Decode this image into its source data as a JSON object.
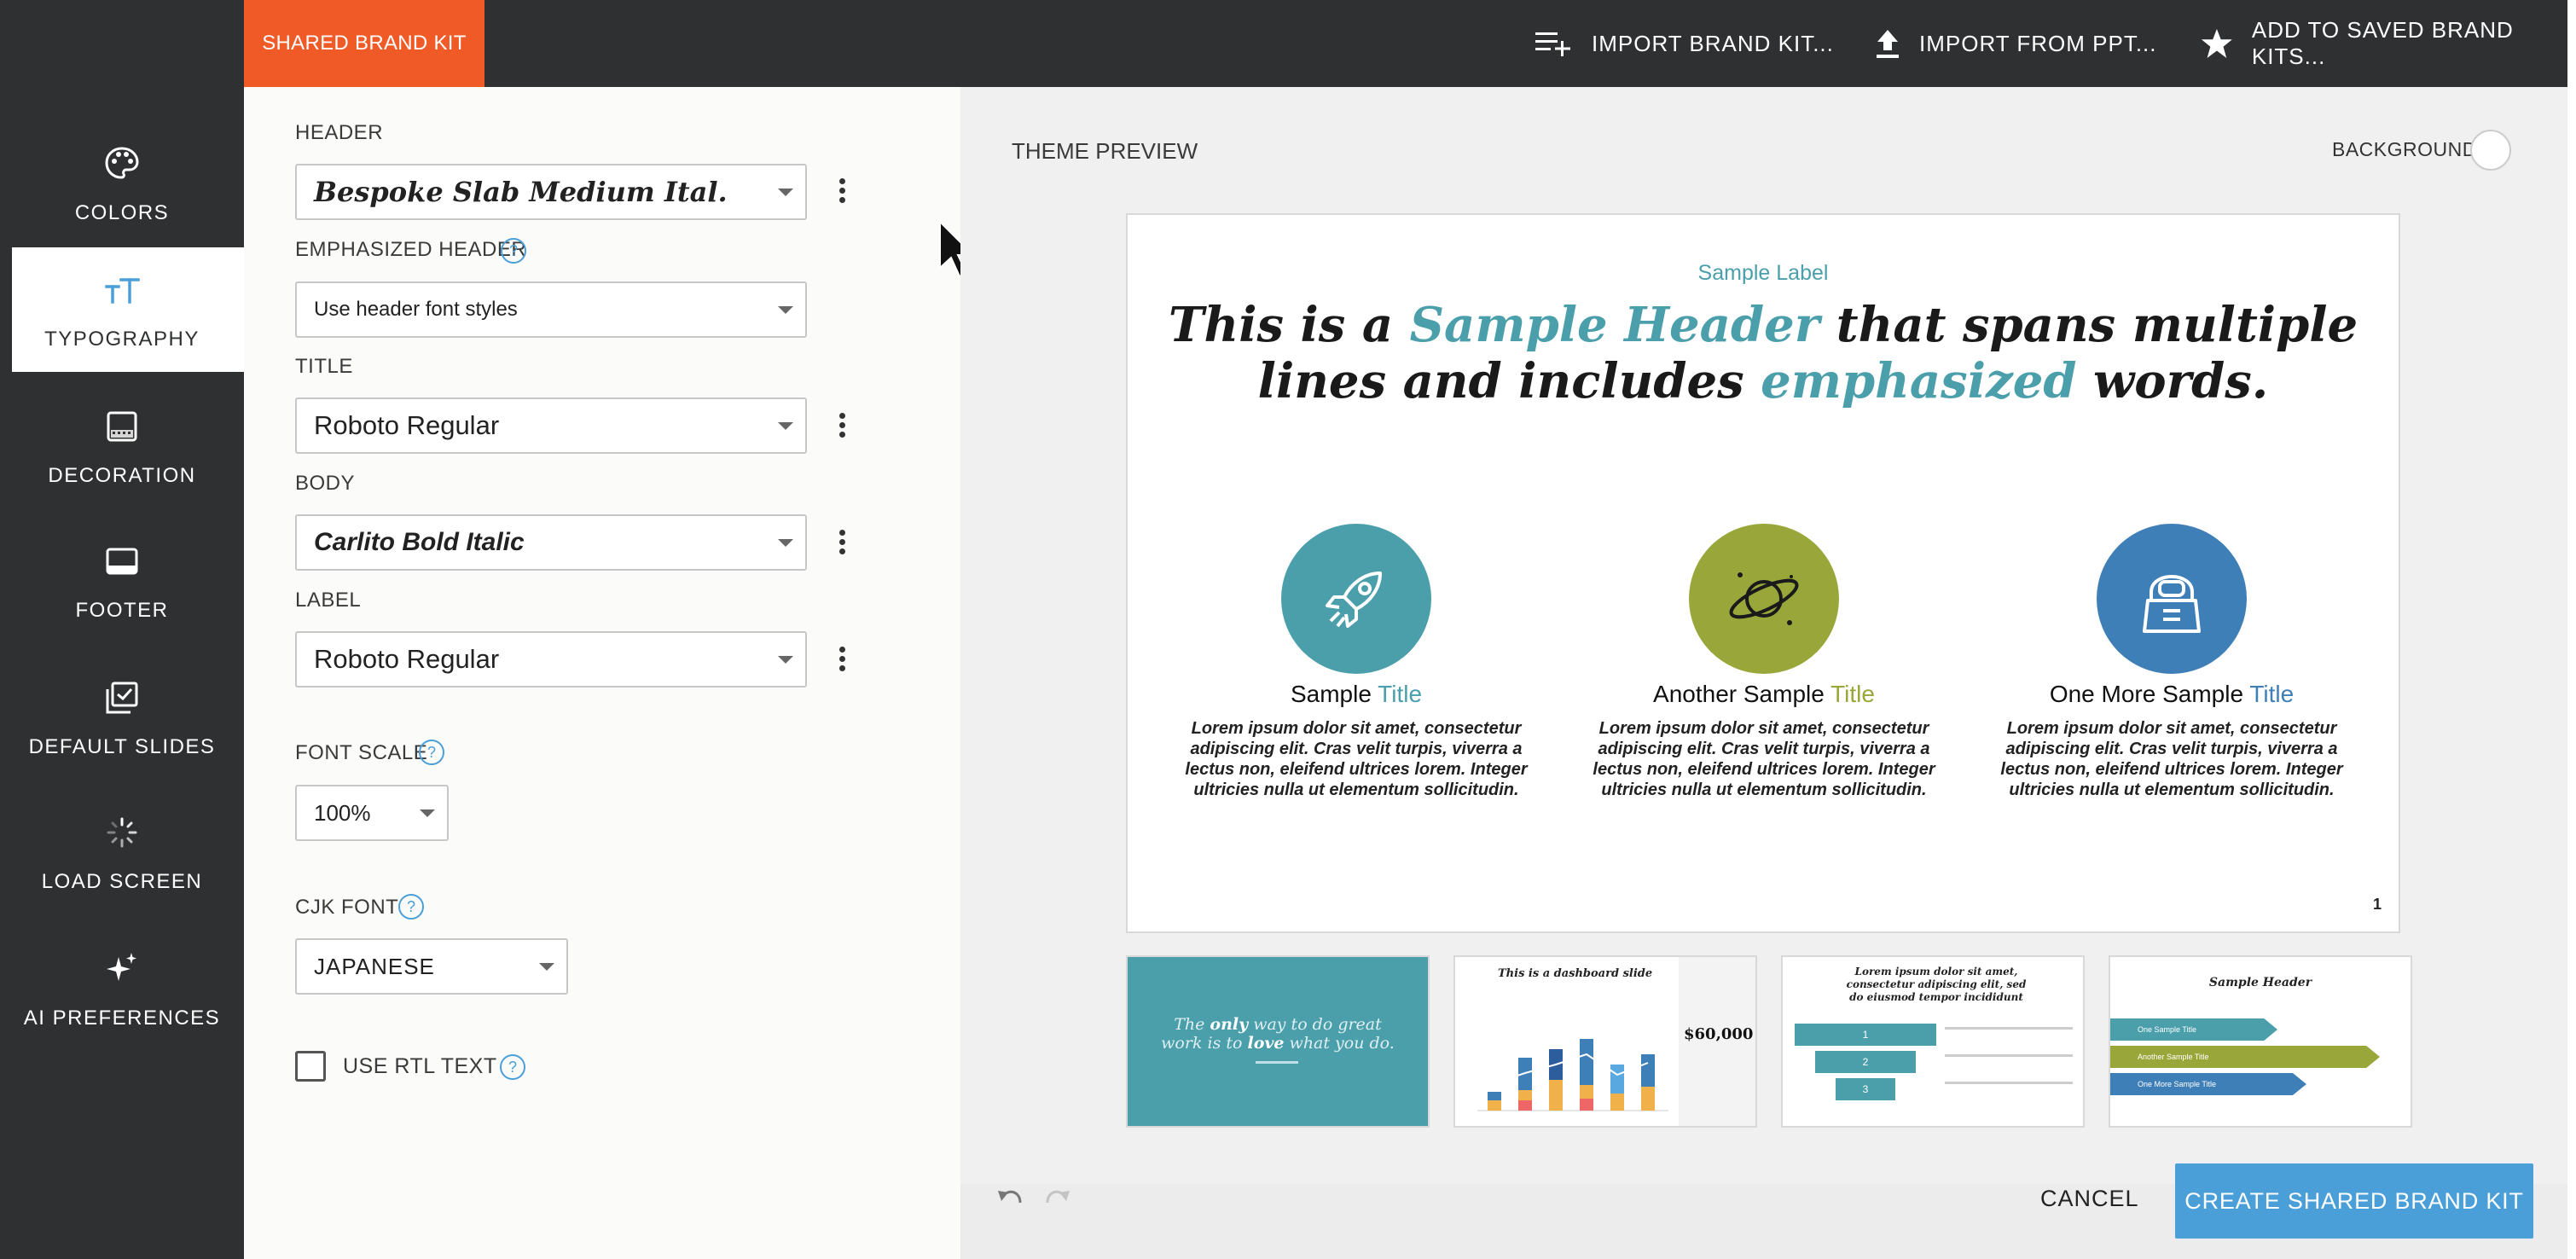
{
  "header": {
    "brand_tab": "SHARED BRAND KIT",
    "actions": {
      "import_brand_kit": "IMPORT BRAND KIT...",
      "import_ppt": "IMPORT FROM PPT...",
      "add_saved": "ADD TO SAVED BRAND KITS..."
    }
  },
  "sidebar": {
    "items": [
      {
        "label": "COLORS",
        "icon": "palette-icon"
      },
      {
        "label": "TYPOGRAPHY",
        "icon": "typography-icon"
      },
      {
        "label": "DECORATION",
        "icon": "decoration-icon"
      },
      {
        "label": "FOOTER",
        "icon": "footer-icon"
      },
      {
        "label": "DEFAULT SLIDES",
        "icon": "default-slides-icon"
      },
      {
        "label": "LOAD SCREEN",
        "icon": "loading-spinner-icon"
      },
      {
        "label": "AI PREFERENCES",
        "icon": "sparkle-icon"
      }
    ],
    "active": "TYPOGRAPHY"
  },
  "settings": {
    "header": {
      "label": "HEADER",
      "value": "Bespoke Slab Medium Ital."
    },
    "emphasized_header": {
      "label": "EMPHASIZED HEADER",
      "value": "Use header font styles"
    },
    "title": {
      "label": "TITLE",
      "value": "Roboto Regular"
    },
    "body": {
      "label": "BODY",
      "value": "Carlito Bold Italic"
    },
    "label": {
      "label": "LABEL",
      "value": "Roboto Regular"
    },
    "font_scale": {
      "label": "FONT SCALE",
      "value": "100%"
    },
    "cjk_font": {
      "label": "CJK FONT",
      "value": "JAPANESE"
    },
    "rtl": {
      "label": "USE RTL TEXT",
      "checked": false
    },
    "help_glyph": "?"
  },
  "preview": {
    "title": "THEME PREVIEW",
    "background_label": "BACKGROUND",
    "slide": {
      "label": "Sample Label",
      "header_parts": [
        "This is a ",
        "Sample Header",
        " that spans multiple",
        "lines and includes ",
        "emphasized",
        " words."
      ],
      "columns": [
        {
          "title_a": "Sample ",
          "title_b": "Title",
          "color": "#4a9fab",
          "icon": "rocket-icon"
        },
        {
          "title_a": "Another Sample ",
          "title_b": "Title",
          "color": "#99a73a",
          "icon": "planet-icon"
        },
        {
          "title_a": "One More Sample ",
          "title_b": "Title",
          "color": "#3f7fb8",
          "icon": "astronaut-icon"
        }
      ],
      "body_text": "Lorem ipsum dolor sit amet, consectetur adipiscing elit. Cras velit turpis, viverra a lectus non, eleifend ultrices lorem. Integer ultricies nulla ut elementum sollicitudin.",
      "page_number": "1"
    },
    "thumbnails": {
      "t1": {
        "a": "The ",
        "b": "only",
        "c": " way to do great",
        "d": "work is to ",
        "e": "love",
        "f": " what you do."
      },
      "t2": {
        "title": "This is a dashboard slide",
        "stat": "$60,000"
      },
      "t3": {
        "title": "Lorem ipsum dolor sit amet, consectetur adipiscing elit, sed do eiusmod tempor incididunt",
        "n1": "1",
        "n2": "2",
        "n3": "3"
      },
      "t4": {
        "title": "Sample Header",
        "row1": "One Sample Title",
        "row2": "Another Sample Title",
        "row3": "One More Sample Title"
      }
    }
  },
  "footer": {
    "cancel": "CANCEL",
    "create": "CREATE SHARED BRAND KIT"
  },
  "colors": {
    "brand_orange": "#f05a27",
    "dark_chrome": "#2f3032",
    "accent_teal": "#4a9fab",
    "accent_olive": "#99a73a",
    "accent_blue": "#3f7fb8",
    "primary_button": "#4a9fd8"
  }
}
